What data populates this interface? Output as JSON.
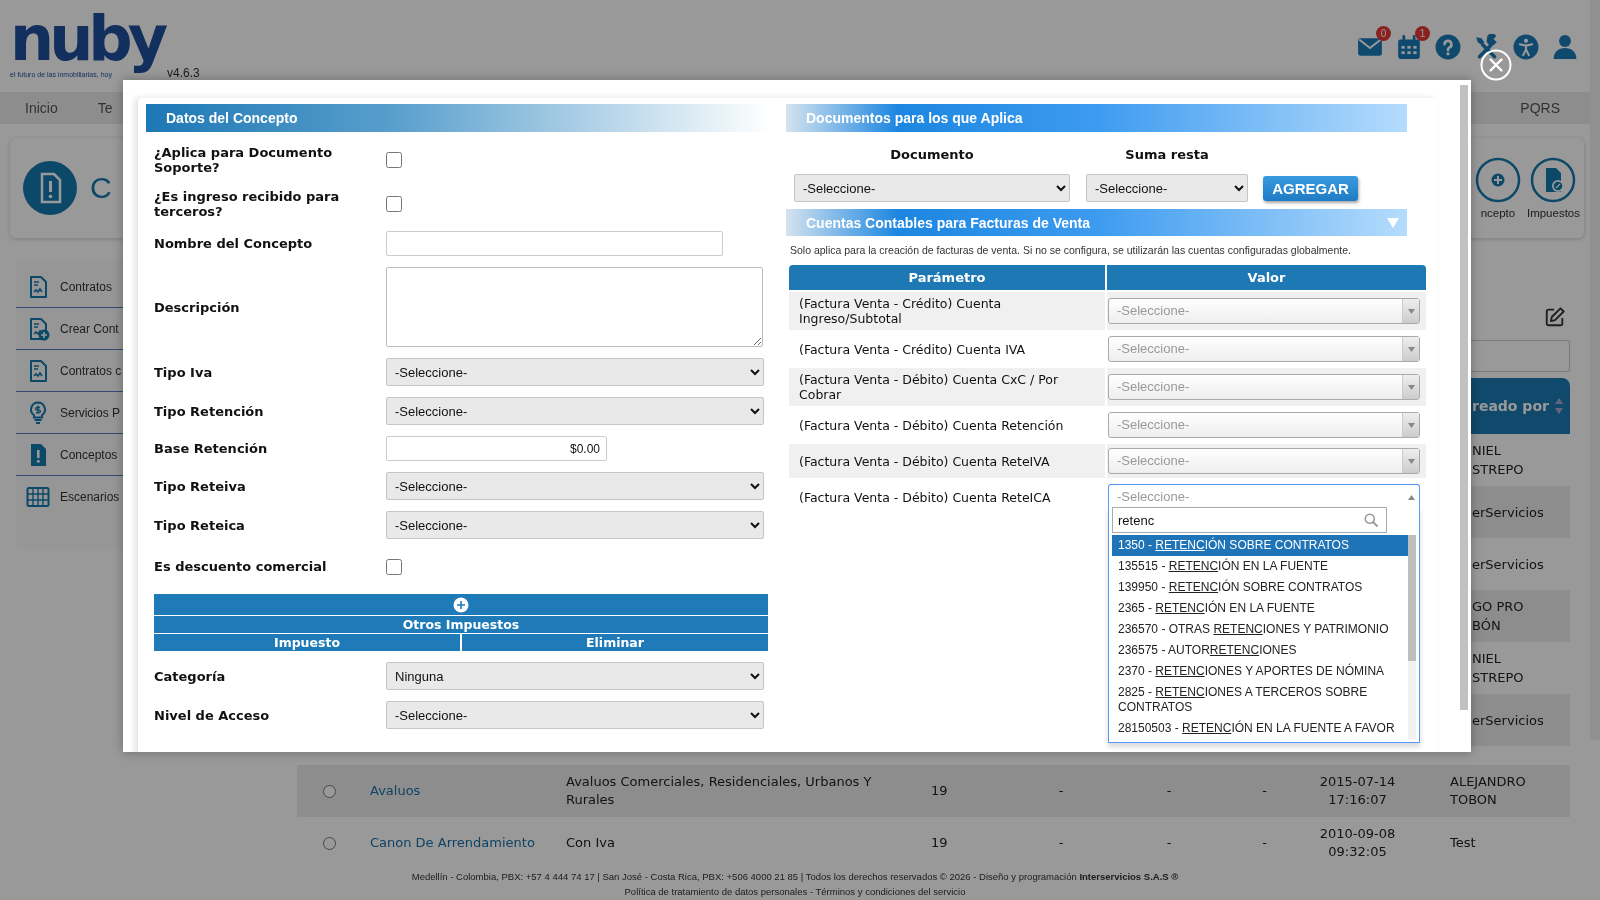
{
  "header": {
    "logo": "nuby",
    "tagline": "el futuro de las inmobiliarias, hoy",
    "version": "v4.6.3",
    "icons": [
      {
        "kind": "mail",
        "badge": "0"
      },
      {
        "kind": "calendar",
        "badge": "1"
      },
      {
        "kind": "help"
      },
      {
        "kind": "tools"
      },
      {
        "kind": "accessibility"
      },
      {
        "kind": "user"
      }
    ]
  },
  "nav": {
    "items": [
      "Inicio",
      "Te"
    ],
    "right_items": [
      "PQRS"
    ]
  },
  "title_card": {
    "title": "C",
    "actions": [
      {
        "kind": "add",
        "label": "ncepto"
      },
      {
        "kind": "tax",
        "label": "Impuestos"
      }
    ]
  },
  "sidebar": {
    "items": [
      {
        "kind": "document",
        "label": "Contratos"
      },
      {
        "kind": "document_add",
        "label": "Crear Cont"
      },
      {
        "kind": "document",
        "label": "Contratos c"
      },
      {
        "kind": "bulb",
        "label": "Servicios P"
      },
      {
        "kind": "document_alert",
        "label": "Conceptos"
      },
      {
        "kind": "grid",
        "label": "Escenarios"
      }
    ]
  },
  "background_table": {
    "column_header": "reado por",
    "column_cells": [
      "NIEL\nSTREPO",
      "erServicios",
      "erServicios",
      "GO PRO\nBÓN",
      "NIEL\nSTREPO",
      "erServicios"
    ],
    "rows": [
      {
        "selected": false,
        "cells": [
          "Avaluos",
          "Avaluos Comerciales, Residenciales, Urbanos Y Rurales",
          "19",
          "-",
          "-",
          "-",
          "2015-07-14 17:16:07",
          "ALEJANDRO TOBON"
        ]
      },
      {
        "selected": false,
        "cells": [
          "Canon De Arrendamiento",
          "Con Iva",
          "19",
          "-",
          "-",
          "-",
          "2010-09-08 09:32:05",
          "Test"
        ]
      }
    ]
  },
  "footer": {
    "line_1": "Medellín - Colombia, PBX: +57 4 444 74 17 | San José - Costa Rica, PBX: +506 4000 21 85 | Todos los derechos reservados © 2026 - Diseño y programación **Interservicios S.A.S ®**",
    "line_2": "Política de tratamiento de datos personales - Términos y condiciones del servicio"
  },
  "modal": {
    "left": {
      "title": "Datos del Concepto",
      "fields": [
        {
          "kind": "checkbox",
          "label": "¿Aplica para Documento Soporte?",
          "checked": false
        },
        {
          "kind": "checkbox",
          "label": "¿Es ingreso recibido para terceros?",
          "checked": false
        },
        {
          "kind": "input",
          "label": "Nombre del Concepto"
        },
        {
          "kind": "textarea",
          "label": "Descripción"
        },
        {
          "kind": "select",
          "label": "Tipo Iva",
          "value": "-Seleccione-"
        },
        {
          "kind": "select",
          "label": "Tipo Retención",
          "value": "-Seleccione-"
        },
        {
          "kind": "money",
          "label": "Base Retención",
          "value": "$0.00"
        },
        {
          "kind": "select",
          "label": "Tipo Reteiva",
          "value": "-Seleccione-"
        },
        {
          "kind": "select",
          "label": "Tipo Reteica",
          "value": "-Seleccione-"
        },
        {
          "kind": "checkbox",
          "label": "Es descuento comercial",
          "checked": false
        },
        {
          "kind": "subtable",
          "title": "Otros Impuestos",
          "columns": [
            "Impuesto",
            "Eliminar"
          ]
        },
        {
          "kind": "select",
          "label": "Categoría",
          "value": "Ninguna"
        },
        {
          "kind": "select",
          "label": "Nivel de Acceso",
          "value": "-Seleccione-"
        }
      ]
    },
    "documents": {
      "title": "Documentos para los que Aplica",
      "columns": [
        "Documento",
        "Suma resta"
      ],
      "selects": [
        "-Seleccione-",
        "-Seleccione-"
      ],
      "button": "AGREGAR"
    },
    "accounts": {
      "title": "Cuentas Contables para Facturas de Venta",
      "note": "Solo aplica para la creación de facturas de venta. Si no se configura, se utilizarán las cuentas configuradas globalmente.",
      "columns": [
        "Parámetro",
        "Valor"
      ],
      "rows": [
        {
          "parameter": "(Factura Venta - Crédito) Cuenta Ingreso/Subtotal",
          "placeholder": "-Seleccione-",
          "open": false
        },
        {
          "parameter": "(Factura Venta - Crédito) Cuenta IVA",
          "placeholder": "-Seleccione-",
          "open": false
        },
        {
          "parameter": "(Factura Venta - Débito) Cuenta CxC / Por Cobrar",
          "placeholder": "-Seleccione-",
          "open": false
        },
        {
          "parameter": "(Factura Venta - Débito) Cuenta Retención",
          "placeholder": "-Seleccione-",
          "open": false
        },
        {
          "parameter": "(Factura Venta - Débito) Cuenta ReteIVA",
          "placeholder": "-Seleccione-",
          "open": false
        },
        {
          "parameter": "(Factura Venta - Débito) Cuenta ReteICA",
          "placeholder": "-Seleccione-",
          "open": true
        }
      ],
      "dropdown": {
        "search": "retenc",
        "options": [
          {
            "before": "1350 - ",
            "match": "RETENC",
            "after": "IÓN SOBRE CONTRATOS",
            "selected": true
          },
          {
            "before": "135515 - ",
            "match": "RETENC",
            "after": "IÓN EN LA FUENTE",
            "selected": false
          },
          {
            "before": "139950 - ",
            "match": "RETENC",
            "after": "IÓN SOBRE CONTRATOS",
            "selected": false
          },
          {
            "before": "2365 - ",
            "match": "RETENC",
            "after": "IÓN EN LA FUENTE",
            "selected": false
          },
          {
            "before": "236570 - OTRAS ",
            "match": "RETENC",
            "after": "IONES Y PATRIMONIO",
            "selected": false
          },
          {
            "before": "236575 - AUTOR",
            "match": "RETENC",
            "after": "IONES",
            "selected": false
          },
          {
            "before": "2370 - ",
            "match": "RETENC",
            "after": "IONES Y APORTES DE NÓMINA",
            "selected": false
          },
          {
            "before": "2825 - ",
            "match": "RETENC",
            "after": "IONES A TERCEROS SOBRE CONTRATOS",
            "selected": false
          },
          {
            "before": "28150503 - ",
            "match": "RETENC",
            "after": "IÓN EN LA FUENTE A FAVOR",
            "selected": false
          }
        ]
      }
    }
  }
}
